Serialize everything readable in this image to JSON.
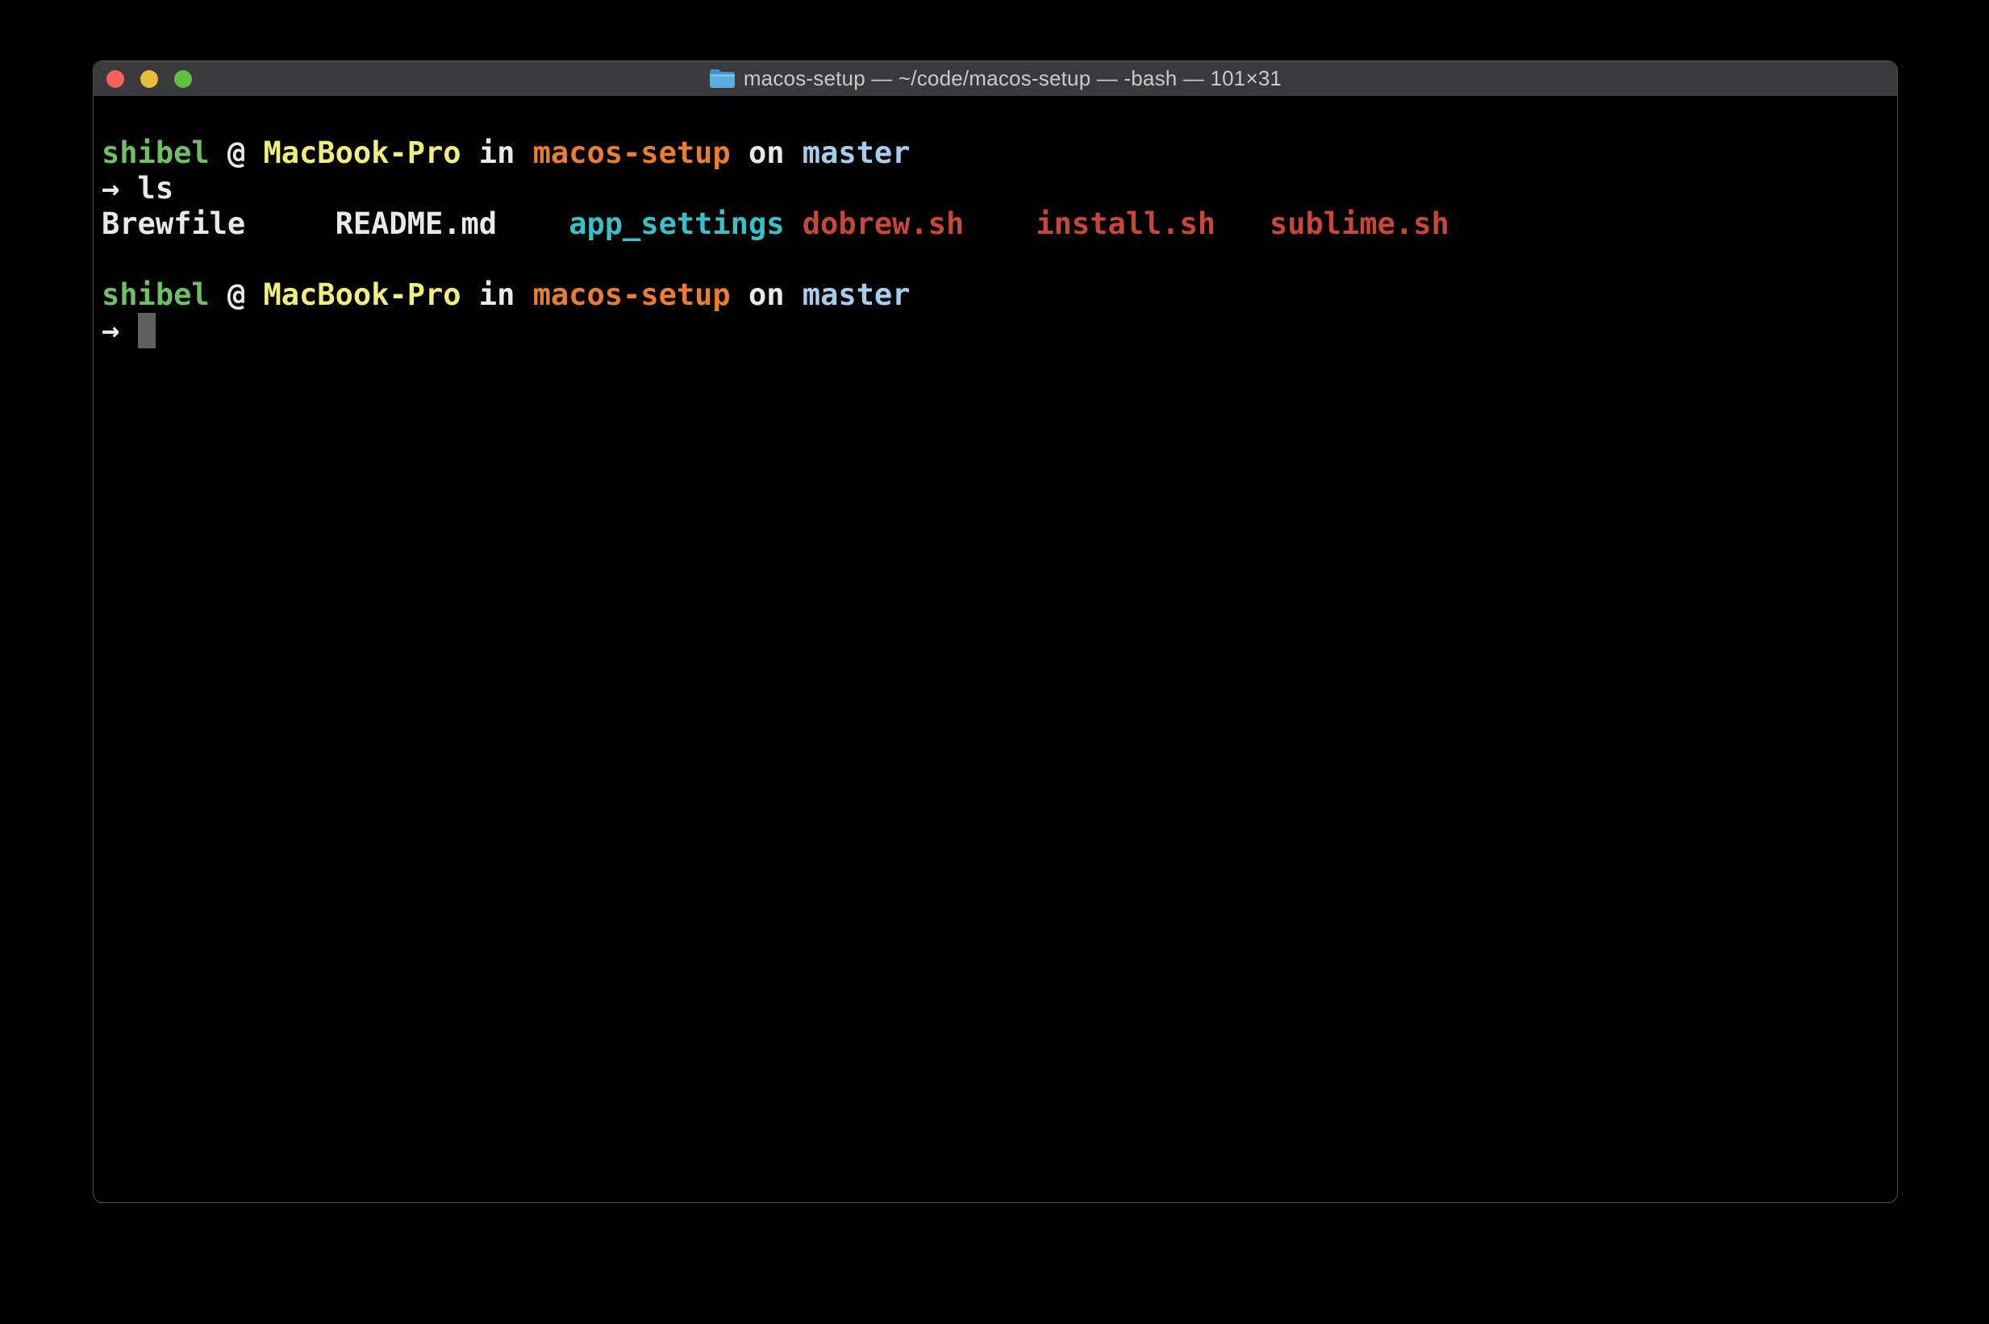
{
  "window": {
    "title": "macos-setup — ~/code/macos-setup — -bash — 101×31",
    "controls": [
      {
        "name": "close",
        "color": "#f4645c"
      },
      {
        "name": "minimize",
        "color": "#e6bd3c"
      },
      {
        "name": "zoom",
        "color": "#5fc044"
      }
    ],
    "titlebar_bg": "#3a3a3c",
    "folder_icon_color": "#58aede"
  },
  "palette": {
    "fg": "#e9e9e7",
    "green": "#72bd68",
    "yellow": "#f1ee80",
    "orange": "#e87d33",
    "blue": "#a7cdee",
    "cyan": "#3cc0c8",
    "red": "#c7473a",
    "cursor": "#606060",
    "background": "#000000"
  },
  "terminal": {
    "columns": 101,
    "rows": 31,
    "lines": [
      {
        "tokens": []
      },
      {
        "tokens": [
          {
            "t": "shibel",
            "c": "green"
          },
          {
            "t": " @ ",
            "c": "fg"
          },
          {
            "t": "MacBook-Pro",
            "c": "yellow"
          },
          {
            "t": " in ",
            "c": "fg"
          },
          {
            "t": "macos-setup",
            "c": "orange"
          },
          {
            "t": " on ",
            "c": "fg"
          },
          {
            "t": "master",
            "c": "blue"
          }
        ]
      },
      {
        "tokens": [
          {
            "t": "→ ls",
            "c": "fg"
          }
        ]
      },
      {
        "tokens": [
          {
            "t": "Brewfile     ",
            "c": "fg"
          },
          {
            "t": "README.md    ",
            "c": "fg"
          },
          {
            "t": "app_settings ",
            "c": "cyan"
          },
          {
            "t": "dobrew.sh    ",
            "c": "red"
          },
          {
            "t": "install.sh   ",
            "c": "red"
          },
          {
            "t": "sublime.sh",
            "c": "red"
          }
        ]
      },
      {
        "tokens": []
      },
      {
        "tokens": [
          {
            "t": "shibel",
            "c": "green"
          },
          {
            "t": " @ ",
            "c": "fg"
          },
          {
            "t": "MacBook-Pro",
            "c": "yellow"
          },
          {
            "t": " in ",
            "c": "fg"
          },
          {
            "t": "macos-setup",
            "c": "orange"
          },
          {
            "t": " on ",
            "c": "fg"
          },
          {
            "t": "master",
            "c": "blue"
          }
        ]
      },
      {
        "tokens": [
          {
            "t": "→ ",
            "c": "fg"
          },
          {
            "t": " ",
            "c": "cursor",
            "cursor": true
          }
        ]
      }
    ]
  }
}
